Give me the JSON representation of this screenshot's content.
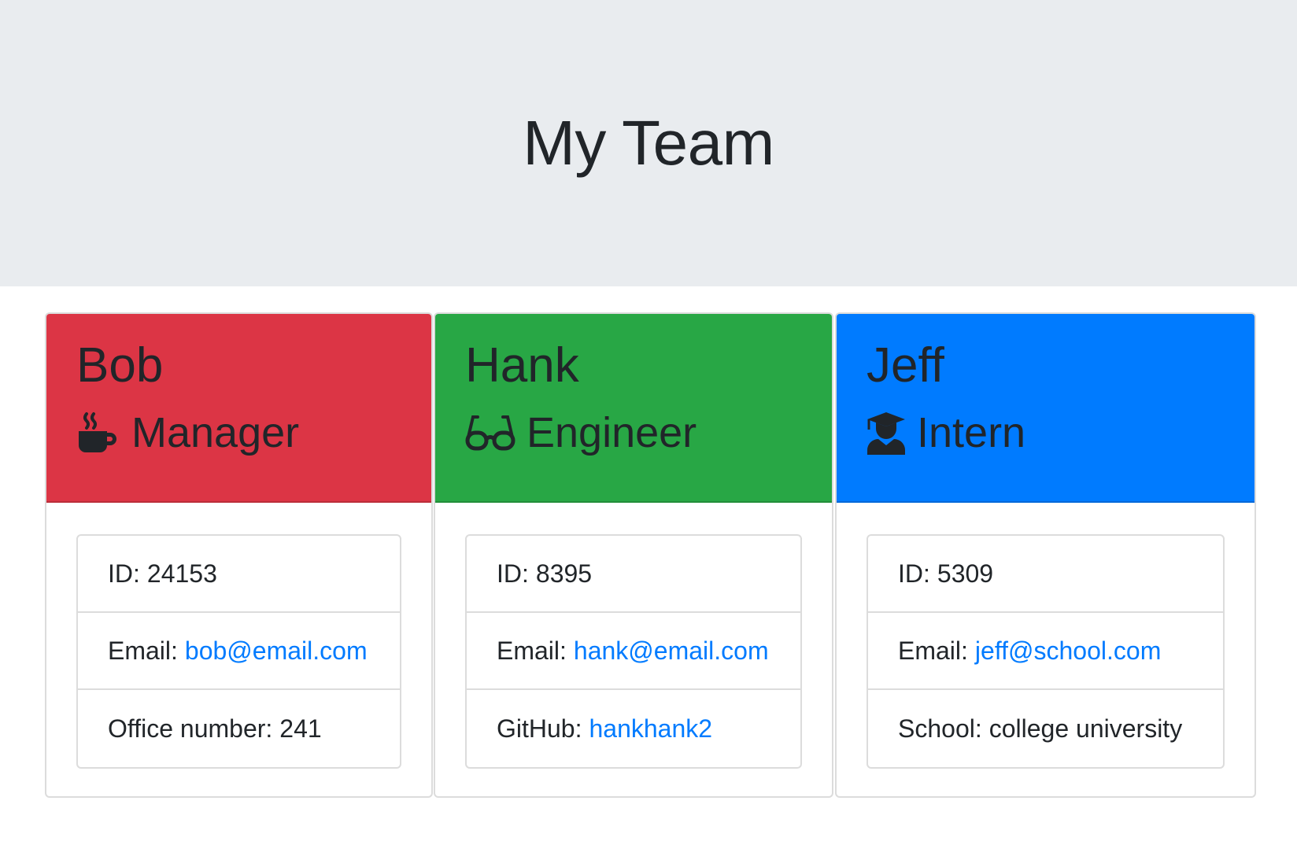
{
  "page": {
    "title": "My Team"
  },
  "colors": {
    "manager_header": "#dc3545",
    "engineer_header": "#28a745",
    "intern_header": "#007bff",
    "link": "#007bff",
    "jumbotron_bg": "#e9ecef"
  },
  "team": [
    {
      "name": "Bob",
      "role": "Manager",
      "icon": "mug-icon",
      "id_label": "ID:",
      "id": "24153",
      "email_label": "Email:",
      "email": "bob@email.com",
      "extra_label": "Office number:",
      "extra_value": "241"
    },
    {
      "name": "Hank",
      "role": "Engineer",
      "icon": "glasses-icon",
      "id_label": "ID:",
      "id": "8395",
      "email_label": "Email:",
      "email": "hank@email.com",
      "extra_label": "GitHub:",
      "extra_value": "hankhank2"
    },
    {
      "name": "Jeff",
      "role": "Intern",
      "icon": "graduate-icon",
      "id_label": "ID:",
      "id": "5309",
      "email_label": "Email:",
      "email": "jeff@school.com",
      "extra_label": "School:",
      "extra_value": "college university"
    }
  ]
}
